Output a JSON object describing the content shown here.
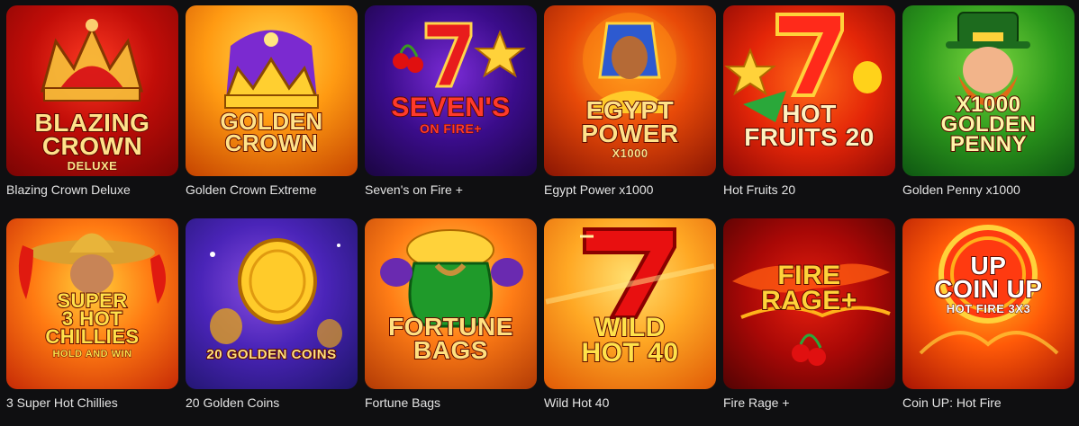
{
  "games": [
    {
      "title": "Blazing Crown Deluxe",
      "logo_lines": [
        "BLAZING",
        "CROWN"
      ],
      "logo_sub": "deluxe",
      "theme": "bg-blazing",
      "icon": "crown-icon"
    },
    {
      "title": "Golden Crown Extreme",
      "logo_lines": [
        "GOLDEN",
        "CROWN"
      ],
      "logo_sub": "",
      "theme": "bg-golden",
      "icon": "crown-icon"
    },
    {
      "title": "Seven's on Fire +",
      "logo_lines": [
        "Seven's"
      ],
      "logo_sub": "ON Fire+",
      "theme": "bg-sevens",
      "icon": "seven-icon"
    },
    {
      "title": "Egypt Power x1000",
      "logo_lines": [
        "EGYPT",
        "POWER"
      ],
      "logo_sub": "x1000",
      "theme": "bg-egypt",
      "icon": "pharaoh-icon"
    },
    {
      "title": "Hot Fruits 20",
      "logo_lines": [
        "HOT",
        "FRUITS 20"
      ],
      "logo_sub": "",
      "theme": "bg-hotfruits",
      "icon": "seven-icon"
    },
    {
      "title": "Golden Penny x1000",
      "logo_lines": [
        "x1000",
        "GOLDEN",
        "PENNY"
      ],
      "logo_sub": "",
      "theme": "bg-penny",
      "icon": "leprechaun-icon"
    },
    {
      "title": "3 Super Hot Chillies",
      "logo_lines": [
        "SUPER",
        "3 HOT",
        "CHILLIES"
      ],
      "logo_sub": "HOLD AND WIN",
      "theme": "bg-chillies",
      "icon": "chilli-icon"
    },
    {
      "title": "20 Golden Coins",
      "logo_lines": [
        "20 GOLDEN COINS"
      ],
      "logo_sub": "",
      "theme": "bg-coins",
      "icon": "coin-icon"
    },
    {
      "title": "Fortune Bags",
      "logo_lines": [
        "FORTUNE",
        "BAGS"
      ],
      "logo_sub": "",
      "theme": "bg-fortune",
      "icon": "money-bag-icon"
    },
    {
      "title": "Wild Hot 40",
      "logo_lines": [
        "WILD",
        "HOT 40"
      ],
      "logo_sub": "",
      "theme": "bg-wild",
      "icon": "seven-icon"
    },
    {
      "title": "Fire Rage +",
      "logo_lines": [
        "Fire",
        "Rage+"
      ],
      "logo_sub": "",
      "theme": "bg-fire",
      "icon": "cherry-icon"
    },
    {
      "title": "Coin UP: Hot Fire",
      "logo_lines": [
        "UP",
        "COIN UP"
      ],
      "logo_sub": "HOT FIRE 3x3",
      "theme": "bg-coinup",
      "icon": "coin-icon"
    }
  ]
}
